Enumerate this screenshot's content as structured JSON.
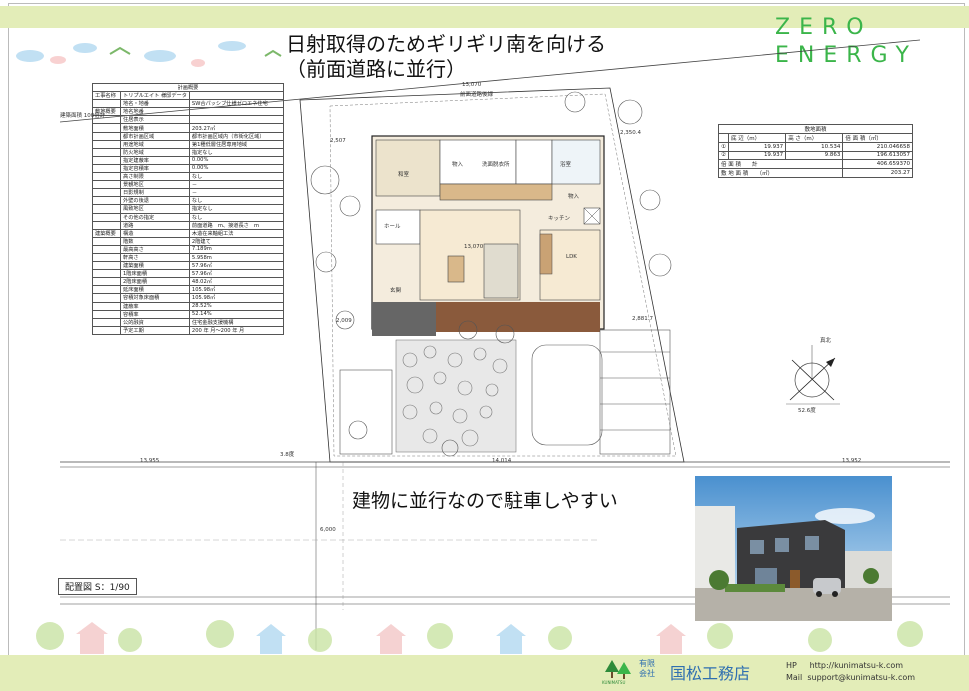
{
  "brand": {
    "line1": "ZERO",
    "line2": "ENERGY"
  },
  "headline": {
    "line1": "日射取得のためギリギリ南を向ける",
    "line2": "（前面道路に並行）"
  },
  "subheadline": "建物に並行なので駐車しやすい",
  "site_plan": {
    "road_front_label": "前面道路後緑",
    "dims": {
      "top_left": "2,507",
      "top_right": "2,350.4",
      "left_mid": "2,009",
      "right_mid": "2,881.7",
      "bottom_left": "13,955",
      "bottom_mid": "14,014",
      "bottom_right": "13,952",
      "angle_left": "3.8度",
      "building_width": "13,070",
      "north_angle": "52.6度",
      "top_edge": "13,070",
      "road_width": "6,000"
    },
    "north_label": "真北",
    "rooms": [
      "物入",
      "洗面脱衣所",
      "浴室",
      "和室",
      "キッチン",
      "ホール",
      "玄関",
      "LDK",
      "物入"
    ]
  },
  "summary_table": {
    "title": "計画概要",
    "rows": [
      [
        "工事名称",
        "トリプルエイト 様邸データ",
        ""
      ],
      [
        "",
        "地名・地番",
        "SW合パッシブ仕様ゼロエネ住宅"
      ],
      [
        "敷地概要",
        "地名地番",
        ""
      ],
      [
        "",
        "住居表示",
        ""
      ],
      [
        "",
        "敷地面積",
        "203.27㎡"
      ],
      [
        "",
        "都市計画区域",
        "都市計画区域内（市街化区域）"
      ],
      [
        "",
        "用途地域",
        "第1種低層住居専用地域"
      ],
      [
        "",
        "防火地域",
        "指定なし"
      ],
      [
        "",
        "指定建蔽率",
        "0.00%"
      ],
      [
        "",
        "指定容積率",
        "0.00%"
      ],
      [
        "",
        "高さ制限",
        "なし"
      ],
      [
        "",
        "景観地区",
        "－"
      ],
      [
        "",
        "日影規制",
        "－"
      ],
      [
        "",
        "外壁の後退",
        "なし"
      ],
      [
        "",
        "風致地区",
        "指定なし"
      ],
      [
        "",
        "その他の指定",
        "なし"
      ],
      [
        "",
        "道路",
        "前面道路　m、接道長さ　m"
      ],
      [
        "建築概要",
        "構造",
        "木造在来軸組工法"
      ],
      [
        "",
        "階数",
        "2階建て"
      ],
      [
        "",
        "最高高さ",
        "7.189m"
      ],
      [
        "",
        "軒高さ",
        "5.958m"
      ],
      [
        "",
        "建築面積",
        "57.96㎡"
      ],
      [
        "",
        "1階床面積",
        "57.96㎡"
      ],
      [
        "",
        "2階床面積",
        "48.02㎡"
      ],
      [
        "",
        "延床面積",
        "105.98㎡"
      ],
      [
        "",
        "容積対象床面積",
        "105.98㎡"
      ],
      [
        "",
        "建蔽率",
        "28.52%"
      ],
      [
        "",
        "容積率",
        "52.14%"
      ],
      [
        "",
        "公的融資",
        "住宅金融支援機構"
      ],
      [
        "",
        "予定工期",
        "200 年 月～200 年 月"
      ]
    ],
    "note": "建築面積 100倍計"
  },
  "area_table": {
    "title": "敷地面積",
    "headers": [
      "底 辺（m）",
      "高 さ（m）",
      "倍 面 積（㎡）"
    ],
    "rows": [
      [
        "①",
        "19.937",
        "10.534",
        "210.046658"
      ],
      [
        "②",
        "19.937",
        "9.863",
        "196.613057"
      ]
    ],
    "total_double_label": "倍 面 積　　計",
    "total_double_value": "406.659370",
    "site_area_label": "敷 地 面 積　　（㎡）",
    "site_area_value": "203.27"
  },
  "scale": "配置図 S：1/90",
  "footer": {
    "logo_text": "KUNIMATSU",
    "corp_kind": "有限会社",
    "company_name": "国松工務店",
    "hp_label": "HP",
    "hp_url": "http://kunimatsu-k.com",
    "mail_label": "Mail",
    "mail_address": "support@kunimatsu-k.com"
  },
  "colors": {
    "accent_green": "#3bb54a",
    "band_green": "#e3edb8",
    "company_blue": "#2f6fb0"
  }
}
